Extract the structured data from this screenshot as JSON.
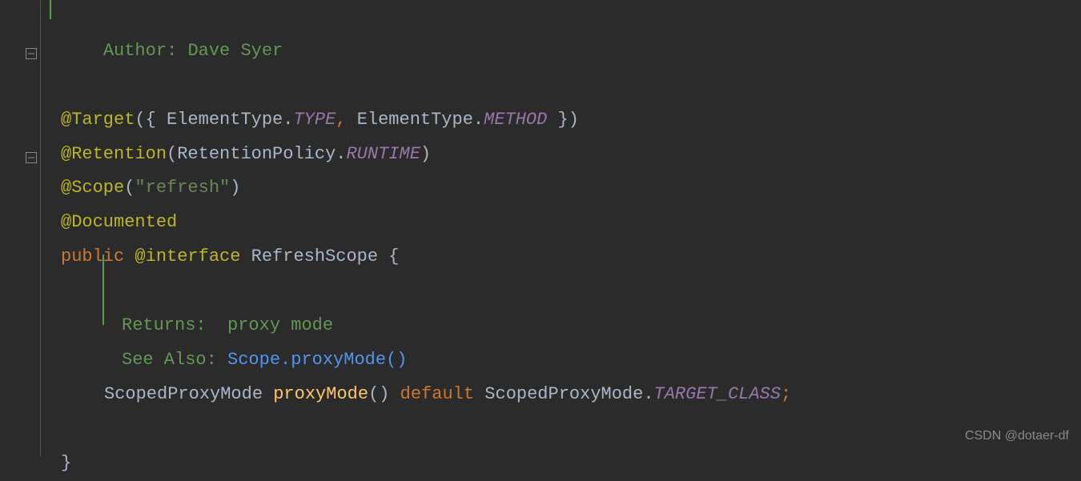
{
  "doc": {
    "author_label": "Author:",
    "author_name": "Dave Syer",
    "returns_label": "Returns:",
    "returns_value": "proxy mode",
    "seealso_label": "See Also:",
    "seealso_link": "Scope.proxyMode()"
  },
  "code": {
    "at_target": "@Target",
    "open_brace_paren": "({ ",
    "elemtype1": "ElementType",
    "dot": ".",
    "type_const": "TYPE",
    "comma": ",",
    "space": " ",
    "elemtype2": "ElementType",
    "method_const": "METHOD",
    "close_brace_paren": " })",
    "at_retention": "@Retention",
    "open_paren": "(",
    "retpol": "RetentionPolicy",
    "runtime_const": "RUNTIME",
    "close_paren": ")",
    "at_scope": "@Scope",
    "refresh_str": "\"refresh\"",
    "at_documented": "@Documented",
    "kw_public": "public ",
    "at_interface": "@interface",
    "class_name": " RefreshScope ",
    "open_curly": "{",
    "scoped_proxy_mode": "ScopedProxyMode ",
    "proxy_mode_method": "proxyMode",
    "parens": "() ",
    "kw_default": "default",
    "scoped_proxy_mode2": " ScopedProxyMode",
    "target_class": "TARGET_CLASS",
    "semicolon": ";",
    "close_curly": "}"
  },
  "watermark": "CSDN @dotaer-df"
}
